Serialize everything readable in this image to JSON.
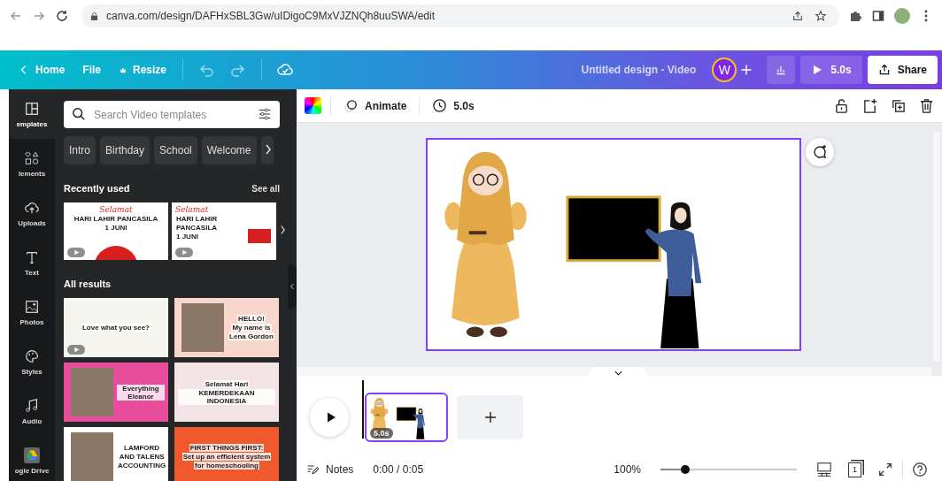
{
  "browser": {
    "url": "canva.com/design/DAFHxSBL3Gw/uIDigoC9MxVJZNQh8uuSWA/edit"
  },
  "top_bar": {
    "home": "Home",
    "file": "File",
    "resize": "Resize",
    "title": "Untitled design - Video",
    "avatar": "W",
    "duration": "5.0s",
    "share": "Share"
  },
  "rail": [
    {
      "label": "emplates",
      "selected": true
    },
    {
      "label": "lements",
      "selected": false
    },
    {
      "label": "Uploads",
      "selected": false
    },
    {
      "label": "Text",
      "selected": false
    },
    {
      "label": "Photos",
      "selected": false
    },
    {
      "label": "Styles",
      "selected": false
    },
    {
      "label": "Audio",
      "selected": false
    },
    {
      "label": "ogle Drive",
      "selected": false
    }
  ],
  "panel": {
    "search_placeholder": "Search Video templates",
    "chips": [
      "Intro",
      "Birthday",
      "School",
      "Welcome"
    ],
    "recent_heading": "Recently used",
    "see_all": "See all",
    "recent": [
      {
        "color": "#ffffff",
        "photo": false,
        "video": true,
        "texts": [
          "Selamat",
          "HARI LAHIR PANCASILA",
          "1 JUNI"
        ]
      },
      {
        "color": "#ffffff",
        "photo": false,
        "video": true,
        "texts": [
          "Selamat",
          "HARI LAHIR",
          "PANCASILA",
          "1 JUNI"
        ]
      }
    ],
    "results_heading": "All results",
    "results": [
      {
        "color": "#f6f4ef",
        "photo": false,
        "video": true,
        "texts": [
          "Love what you see?"
        ]
      },
      {
        "color": "#f9d6cc",
        "photo": true,
        "video": false,
        "texts": [
          "HELLO!",
          "My name is",
          "Lena Gordon"
        ]
      },
      {
        "color": "#e84c9d",
        "photo": true,
        "video": false,
        "texts": [
          "Everything Eleanor"
        ]
      },
      {
        "color": "#f2e4e4",
        "photo": false,
        "video": false,
        "texts": [
          "Selamat Hari",
          "KEMERDEKAAN INDONESIA"
        ]
      },
      {
        "color": "#ffffff",
        "photo": true,
        "video": false,
        "texts": [
          "LAMFORD",
          "AND TALENS",
          "ACCOUNTING"
        ]
      },
      {
        "color": "#f0592b",
        "photo": false,
        "video": false,
        "texts": [
          "FIRST THINGS FIRST:",
          "Set up an efficient system",
          "for homeschooling"
        ]
      }
    ]
  },
  "toolbar": {
    "animate": "Animate",
    "duration": "5.0s"
  },
  "timeline": {
    "clip_duration": "5.0s"
  },
  "footer": {
    "notes": "Notes",
    "time": "0:00 / 0:05",
    "zoom": "100%",
    "level": 0.18,
    "page_count": "1"
  }
}
